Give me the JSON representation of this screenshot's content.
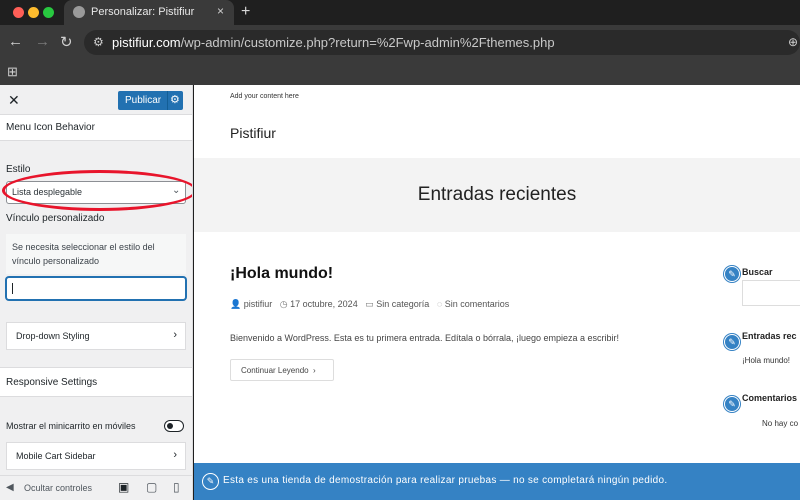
{
  "browser": {
    "tab_title": "Personalizar: Pistifiur",
    "tab_close": "×",
    "new_tab": "+",
    "url_domain": "pistifiur.com",
    "url_path": "/wp-admin/customize.php?return=%2Fwp-admin%2Fthemes.php",
    "traffic_lights": {
      "close": "#ff5f57",
      "minimize": "#febc2e",
      "maximize": "#28c840"
    },
    "icons": [
      "back-arrow-icon",
      "forward-arrow-icon",
      "reload-icon",
      "site-settings-icon",
      "apps-grid-icon",
      "zoom-icon"
    ]
  },
  "sidebar": {
    "close": "✕",
    "publish_label": "Publicar",
    "section_title": "Menu Icon Behavior",
    "style_label": "Estilo",
    "style_value": "Lista desplegable",
    "custom_link_label": "Vínculo personalizado",
    "custom_link_notice": "Se necesita seleccionar el estilo del vínculo personalizado",
    "custom_link_value": "",
    "dropdown_styling": "Drop-down Styling",
    "responsive_settings": "Responsive Settings",
    "mini_cart_label": "Mostrar el minicarrito en móviles",
    "mini_cart_enabled": false,
    "mobile_cart_sidebar": "Mobile Cart Sidebar",
    "hide_controls": "Ocultar controles",
    "accent_color": "#2271b1",
    "highlight_color": "#e8142b"
  },
  "preview": {
    "top_note": "Add your content here",
    "site_title": "Pistifiur",
    "banner_title": "Entradas recientes",
    "post": {
      "title": "¡Hola mundo!",
      "author": "pistifiur",
      "date": "17 octubre, 2024",
      "category": "Sin categoría",
      "comments": "Sin comentarios",
      "excerpt": "Bienvenido a WordPress. Esta es tu primera entrada. Edítala o bórrala, ¡luego empieza a escribir!",
      "read_more": "Continuar Leyendo"
    },
    "widgets": {
      "search": "Buscar",
      "recent_posts": "Entradas rec",
      "recent_post_item": "¡Hola mundo!",
      "comments": "Comentarios",
      "comments_item": "No hay co"
    },
    "store_notice": "Esta es una tienda de demostración para realizar pruebas — no se completará ningún pedido.",
    "notice_color": "#3582c4"
  }
}
